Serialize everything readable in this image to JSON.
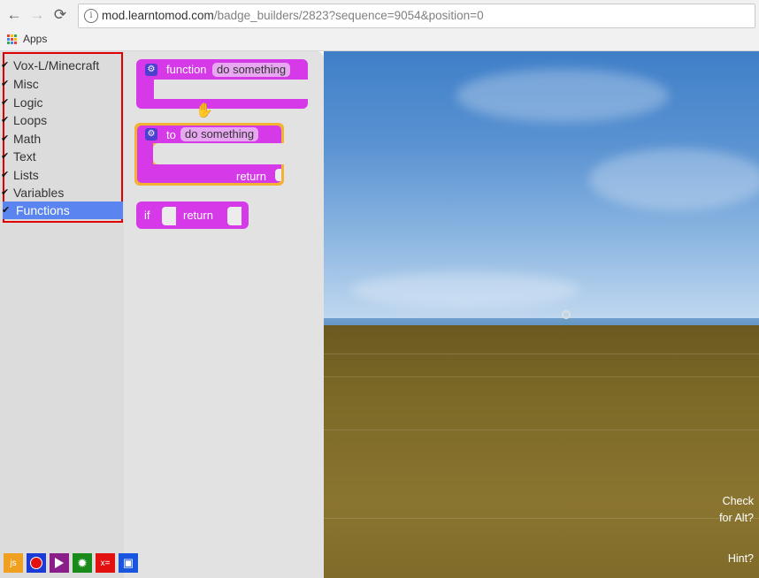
{
  "browser": {
    "url_host": "mod.learntomod.com",
    "url_path": "/badge_builders/2823?sequence=9054&position=0",
    "bookmarks_apps_label": "Apps",
    "back_glyph": "←",
    "forward_glyph": "→",
    "reload_glyph": "⟳"
  },
  "toolbox": {
    "categories": [
      {
        "label": "Vox-L/Minecraft"
      },
      {
        "label": "Misc"
      },
      {
        "label": "Logic"
      },
      {
        "label": "Loops"
      },
      {
        "label": "Math"
      },
      {
        "label": "Text"
      },
      {
        "label": "Lists"
      },
      {
        "label": "Variables"
      },
      {
        "label": "Functions",
        "selected": true
      }
    ],
    "highlight_color": "#e00000",
    "selected_color": "#5a84f0"
  },
  "flyout": {
    "function_block": {
      "keyword": "function",
      "name": "do something"
    },
    "to_block": {
      "keyword": "to",
      "name": "do something",
      "return_label": "return"
    },
    "if_return_block": {
      "if_label": "if",
      "return_label": "return"
    },
    "block_color": "#d63ae8"
  },
  "scene": {
    "check_alt_line1": "Check",
    "check_alt_line2": "for Alt?",
    "hint_label": "Hint?"
  },
  "dock": {
    "js_label": "js",
    "vars_label": "x="
  }
}
